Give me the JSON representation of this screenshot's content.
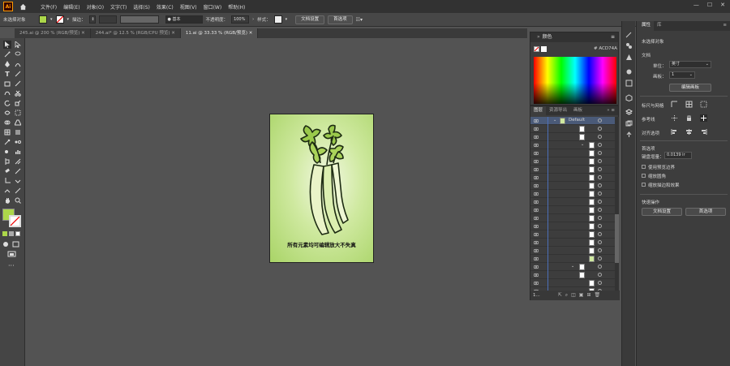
{
  "app": {
    "logo": "Ai"
  },
  "menu": [
    "文件(F)",
    "编辑(E)",
    "对象(O)",
    "文字(T)",
    "选择(S)",
    "效果(C)",
    "视图(V)",
    "窗口(W)",
    "帮助(H)"
  ],
  "window_controls": [
    "—",
    "☐",
    "✕"
  ],
  "control_bar": {
    "selection": "未选择对象",
    "stroke_label": "描边：",
    "brush": "● 基本",
    "opacity_label": "不透明度：",
    "opacity_value": "100%",
    "style_label": "样式：",
    "doc_settings": "文档设置",
    "preferences": "首选项"
  },
  "tabs": [
    {
      "label": "245.ai @ 200 % (RGB/预览)",
      "active": false
    },
    {
      "label": "244.ai* @ 12.5 % (RGB/CPU 预览)",
      "active": false
    },
    {
      "label": "11.ai @ 33.33 % (RGB/预览)",
      "active": true
    }
  ],
  "canvas": {
    "caption": "所有元素均可编辑放大不失真"
  },
  "color_panel": {
    "title": "颜色",
    "hex": "ACD74A"
  },
  "layers_panel": {
    "tabs": [
      "图层",
      "资源导出",
      "画板"
    ],
    "top_layer": "Default",
    "footer_count": "1..."
  },
  "properties": {
    "tabs": [
      "属性",
      "库"
    ],
    "no_selection": "未选择对象",
    "doc_section": "文档",
    "unit_label": "单位：",
    "unit_value": "英寸",
    "artboard_label": "画板：",
    "artboard_value": "1",
    "edit_artboard": "编辑画板",
    "rulers_grid": "标尺与网格",
    "guides": "参考线",
    "align_options": "对齐选项",
    "prefs_section": "首选项",
    "keyboard_increment_label": "键盘增量：",
    "keyboard_increment_value": "0.0139 ir",
    "checkboxes": [
      "使用预览边界",
      "缩放圆角",
      "缩放描边和效果"
    ],
    "quick_actions": "快速操作",
    "quick_doc_settings": "文档设置",
    "quick_prefs": "首选项"
  },
  "colors": {
    "accent_blue": "#4c6fb8",
    "fill_color": "#ACD74A"
  }
}
